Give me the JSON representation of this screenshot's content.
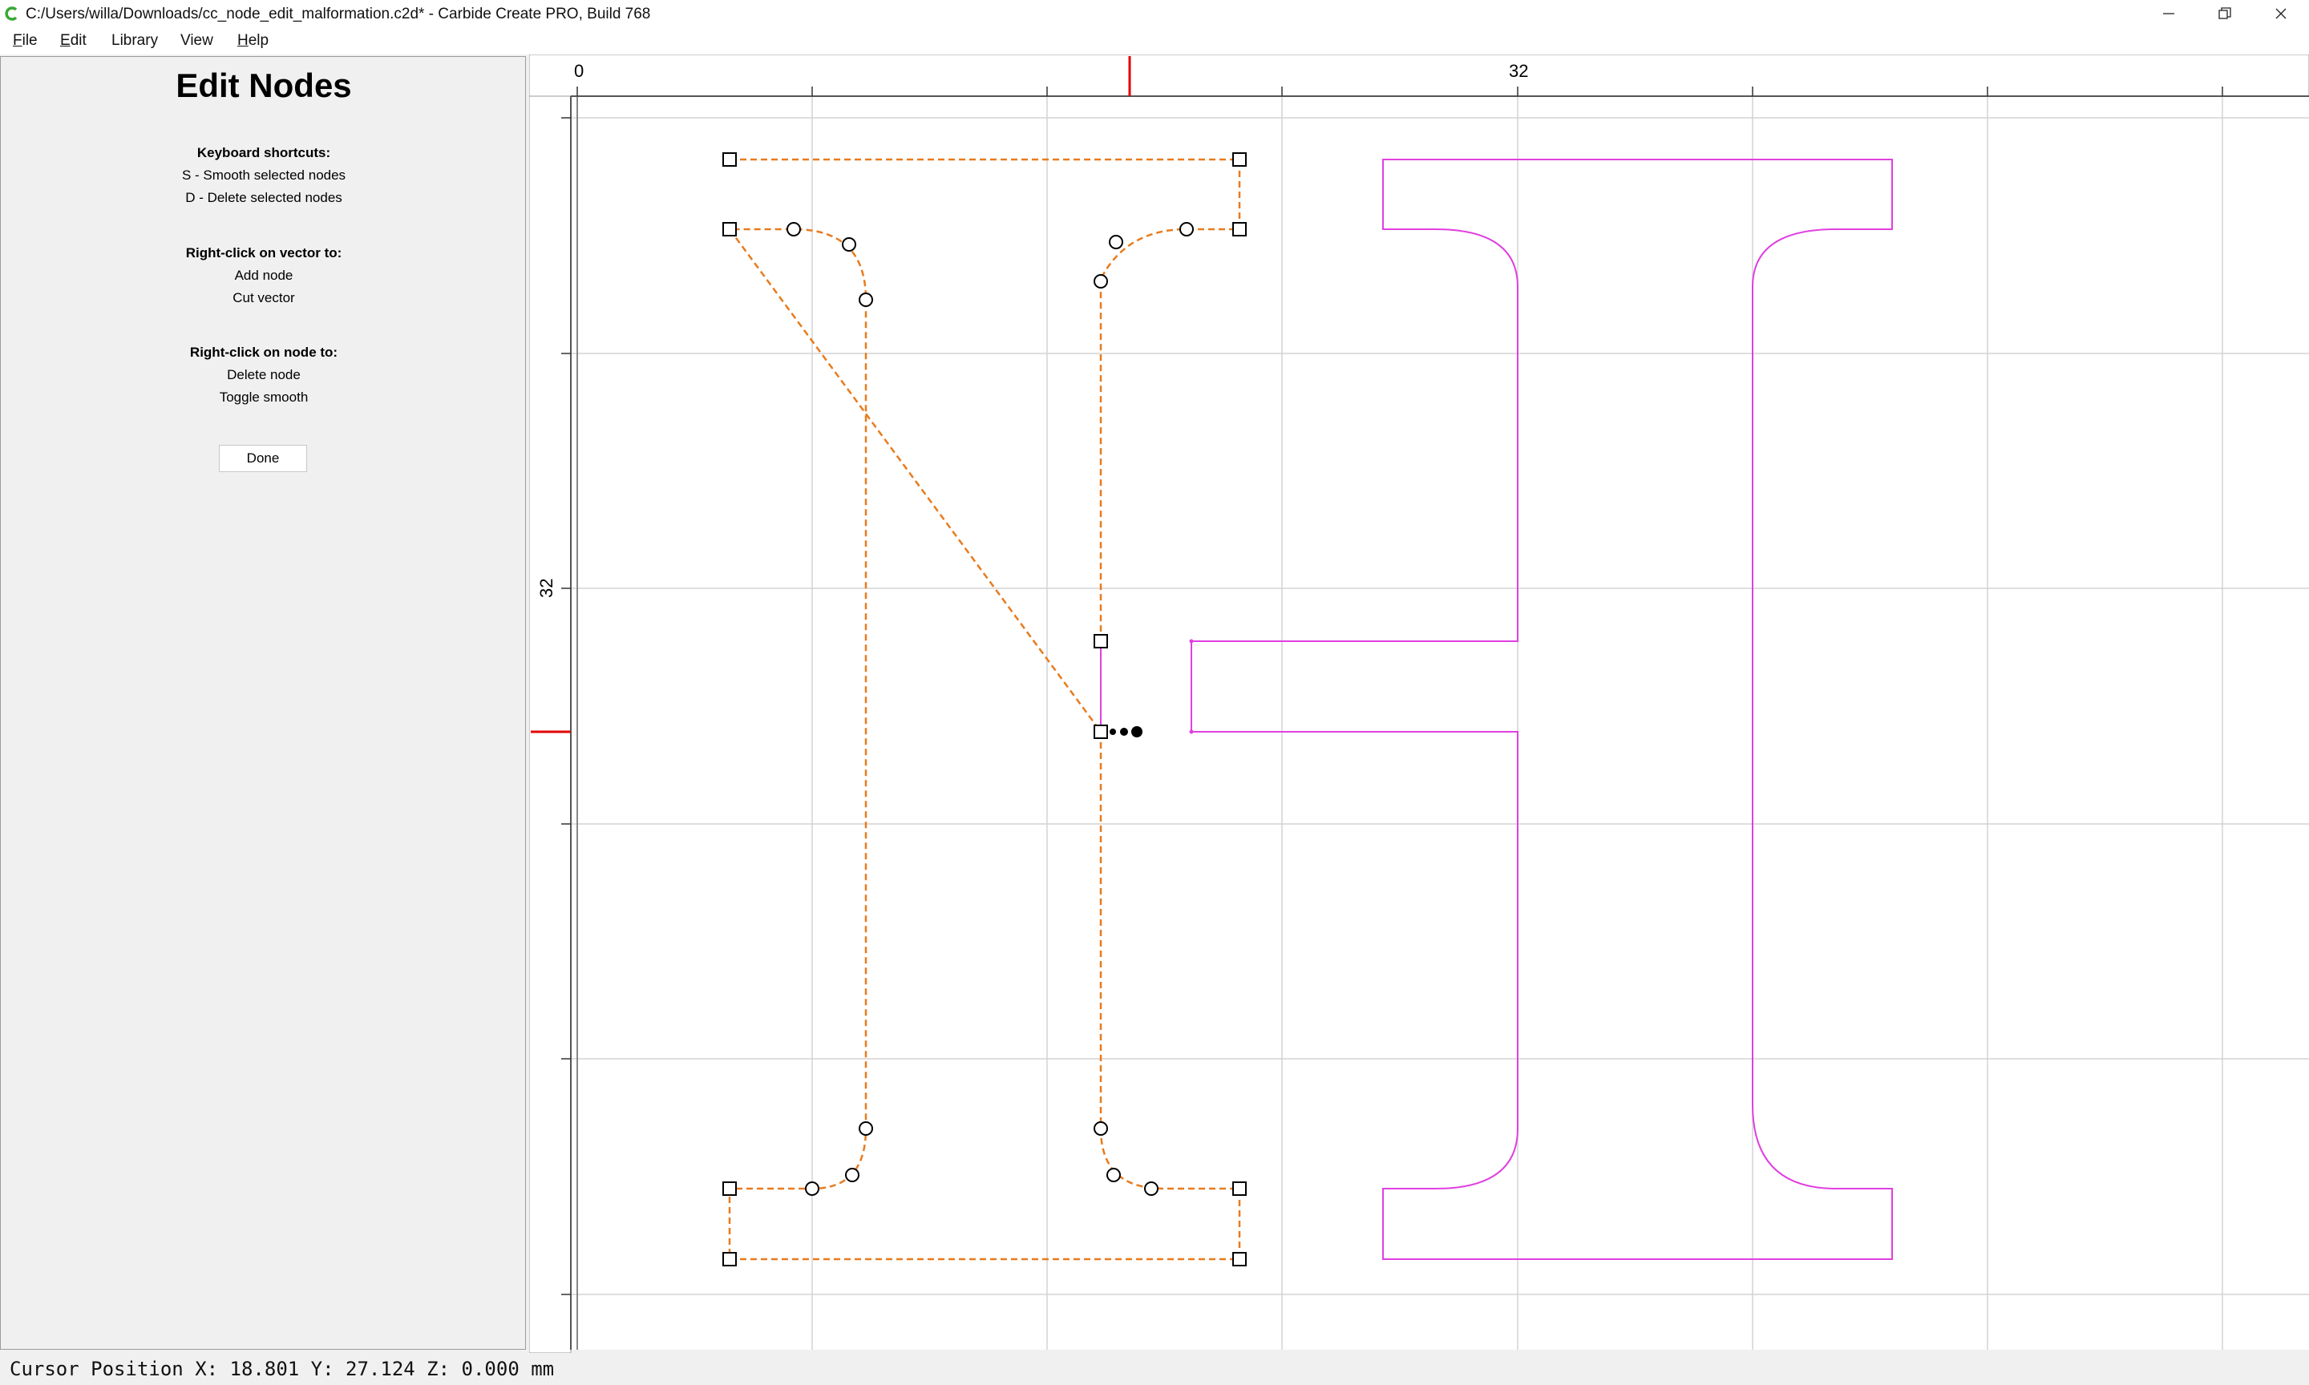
{
  "window": {
    "title": "C:/Users/willa/Downloads/cc_node_edit_malformation.c2d* - Carbide Create PRO, Build 768",
    "controls": [
      "minimize-icon",
      "restore-icon",
      "close-icon"
    ]
  },
  "menu": {
    "file": {
      "underlined": "F",
      "rest": "ile"
    },
    "edit": {
      "underlined": "E",
      "rest": "dit"
    },
    "library": {
      "underlined": "",
      "rest": "Library"
    },
    "view": {
      "underlined": "",
      "rest": "View"
    },
    "help": {
      "underlined": "H",
      "rest": "elp"
    }
  },
  "panel": {
    "title": "Edit Nodes",
    "keyboard_heading": "Keyboard shortcuts:",
    "keyboard_items": [
      "S - Smooth selected nodes",
      "D - Delete selected nodes"
    ],
    "vector_heading": "Right-click on vector to:",
    "vector_items": [
      "Add node",
      "Cut vector"
    ],
    "node_heading": "Right-click on node to:",
    "node_items": [
      "Delete node",
      "Toggle smooth"
    ],
    "done_label": "Done"
  },
  "rulers": {
    "top_labels": [
      "0",
      "32"
    ],
    "left_labels": [
      "32"
    ]
  },
  "colors": {
    "selected_vector": "#e87b1e",
    "other_vector": "#e040e0",
    "ruler_marker": "#e00000",
    "grid": "#d4d4d4"
  },
  "status": {
    "cursor_position": "Cursor Position X: 18.801 Y: 27.124 Z: 0.000 mm"
  }
}
